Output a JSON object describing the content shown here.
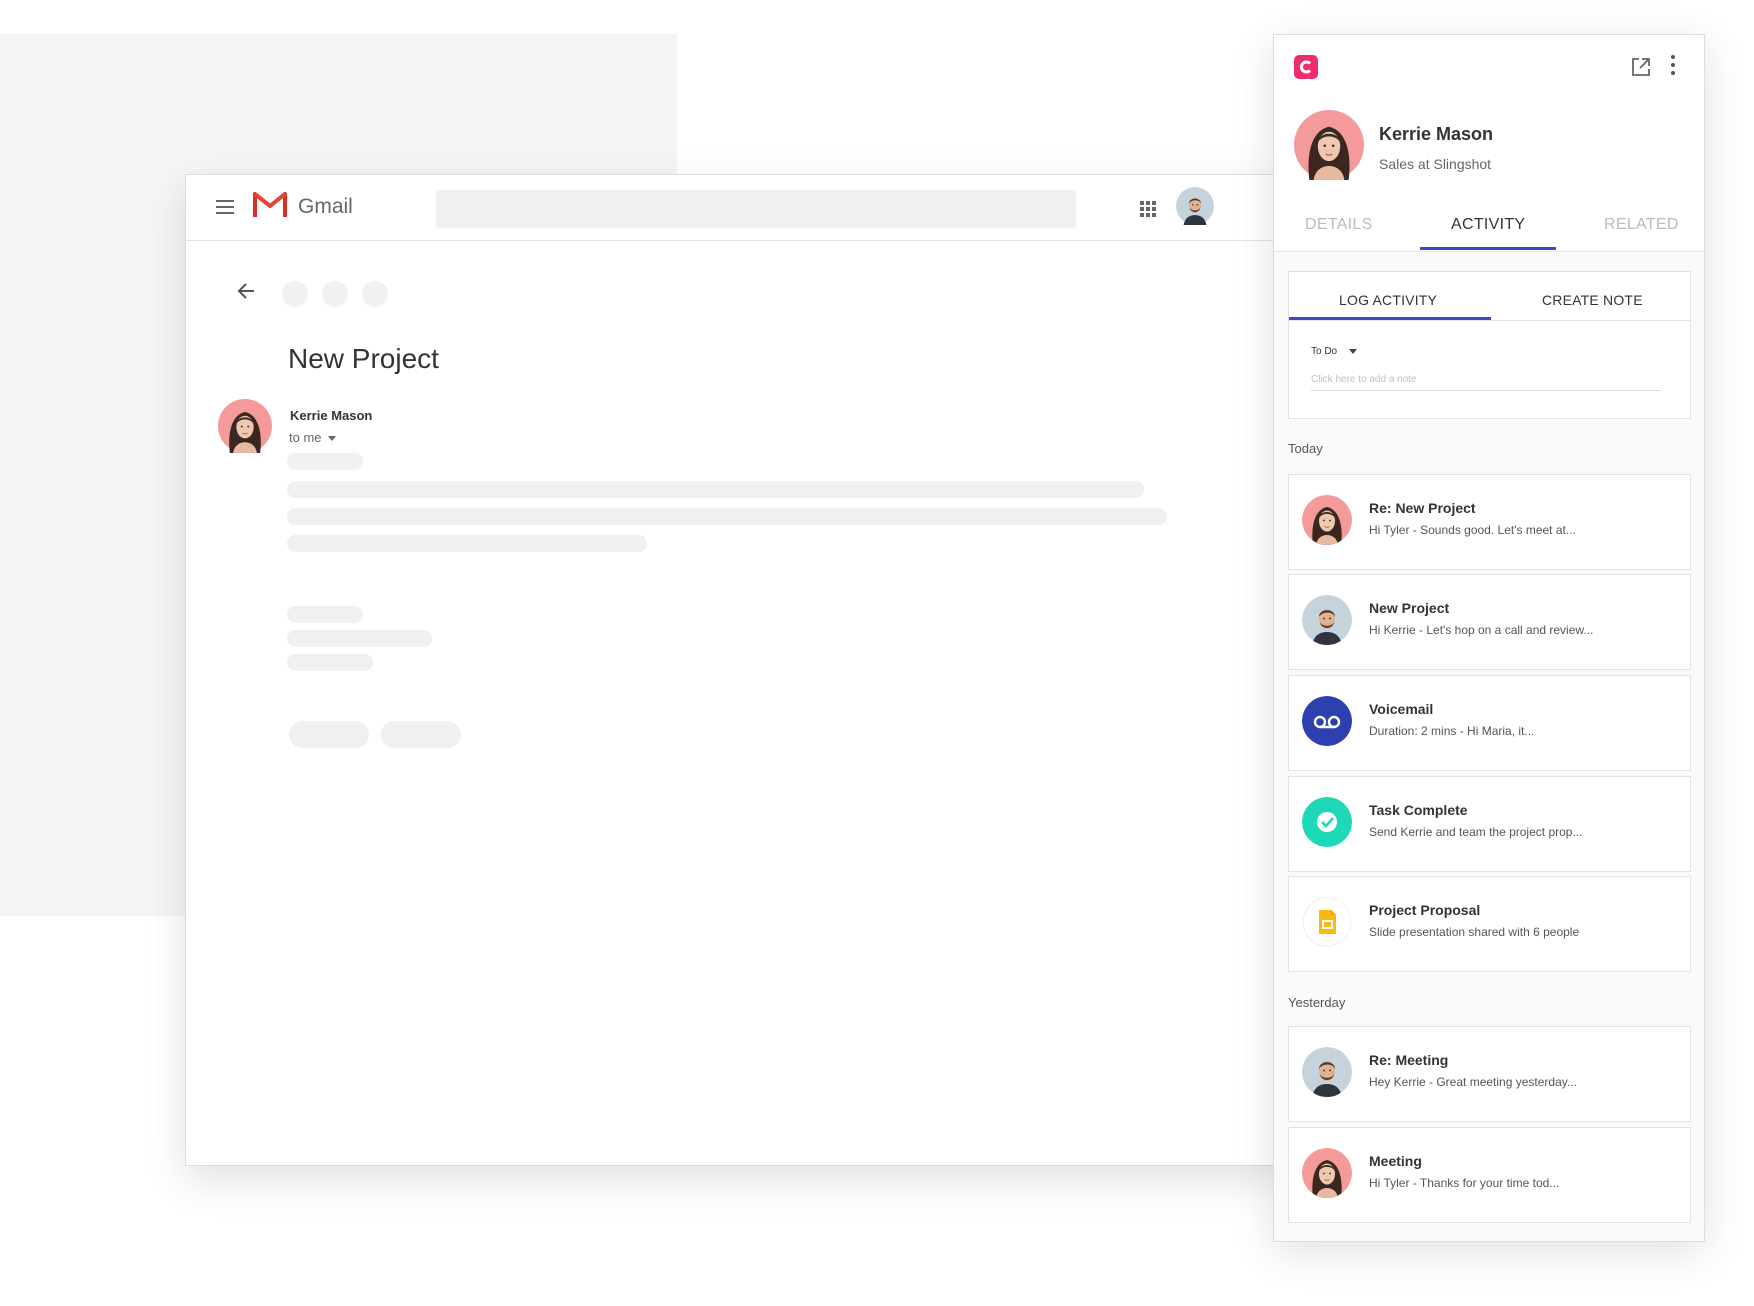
{
  "gmail": {
    "app_name": "Gmail",
    "email": {
      "subject": "New Project",
      "sender": "Kerrie Mason",
      "recipient": "to me"
    }
  },
  "panel": {
    "contact": {
      "name": "Kerrie Mason",
      "role": "Sales at Slingshot"
    },
    "tabs": [
      {
        "label": "DETAILS",
        "active": false
      },
      {
        "label": "ACTIVITY",
        "active": true
      },
      {
        "label": "RELATED",
        "active": false
      }
    ],
    "composer": {
      "tabs": [
        {
          "label": "LOG ACTIVITY",
          "active": true
        },
        {
          "label": "CREATE NOTE",
          "active": false
        }
      ],
      "type": "To Do",
      "placeholder": "Click here to add a note"
    },
    "sections": [
      {
        "label": "Today"
      },
      {
        "label": "Yesterday"
      }
    ],
    "activities": [
      {
        "title": "Re: New Project",
        "preview": "Hi Tyler -  Sounds good. Let's meet at...",
        "icon": "kerrie-avatar"
      },
      {
        "title": "New Project",
        "preview": "Hi Kerrie - Let's hop on a call and review...",
        "icon": "tyler-avatar"
      },
      {
        "title": "Voicemail",
        "preview": "Duration: 2 mins -  Hi Maria, it...",
        "icon": "voicemail-icon"
      },
      {
        "title": "Task Complete",
        "preview": "Send Kerrie and team the project prop...",
        "icon": "check-circle-icon"
      },
      {
        "title": "Project Proposal",
        "preview": "Slide presentation shared with 6 people",
        "icon": "slides-icon"
      },
      {
        "title": "Re: Meeting",
        "preview": "Hey Kerrie - Great meeting yesterday...",
        "icon": "tyler-avatar"
      },
      {
        "title": "Meeting",
        "preview": "Hi Tyler - Thanks for your time tod...",
        "icon": "kerrie-avatar"
      }
    ],
    "colors": {
      "brand": "#ef2c6e",
      "tab_accent": "#3b4cc0",
      "voicemail": "#2e3fb0",
      "task_complete": "#1ed9b8",
      "slides": "#f9b90f"
    }
  }
}
